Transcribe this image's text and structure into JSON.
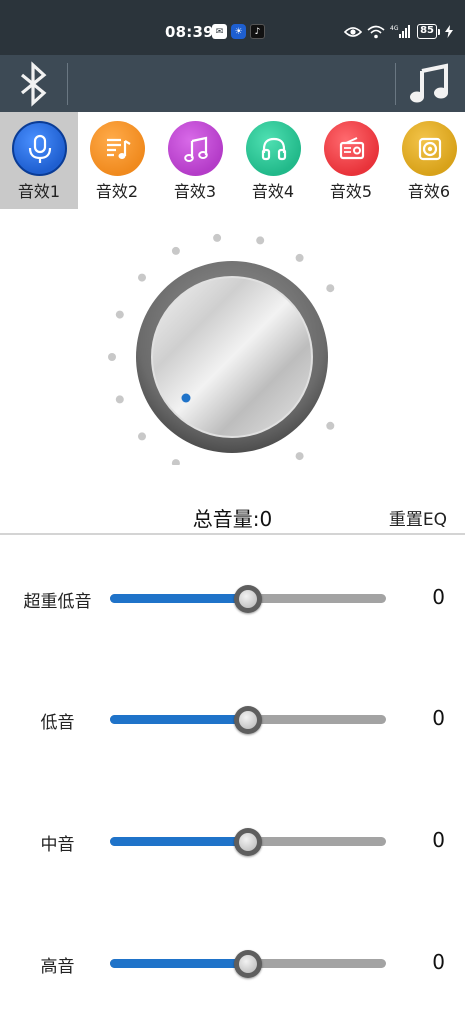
{
  "status": {
    "time": "08:39",
    "battery": "85",
    "network": "4G"
  },
  "presets": [
    {
      "label": "音效1",
      "color": "#1f5fd0",
      "icon": "microphone-icon",
      "active": true
    },
    {
      "label": "音效2",
      "color": "#f08a1e",
      "icon": "music-list-icon",
      "active": false
    },
    {
      "label": "音效3",
      "color": "#b43cc8",
      "icon": "music-note-icon",
      "active": false
    },
    {
      "label": "音效4",
      "color": "#22b98a",
      "icon": "headphones-icon",
      "active": false
    },
    {
      "label": "音效5",
      "color": "#e8333a",
      "icon": "radio-icon",
      "active": false
    },
    {
      "label": "音效6",
      "color": "#d8a21a",
      "icon": "speaker-icon",
      "active": false
    }
  ],
  "volume": {
    "label": "总音量:0",
    "reset_label": "重置EQ",
    "level": 0
  },
  "eq": [
    {
      "label": "超重低音",
      "value": "0",
      "position": 0.5
    },
    {
      "label": "低音",
      "value": "0",
      "position": 0.5
    },
    {
      "label": "中音",
      "value": "0",
      "position": 0.5
    },
    {
      "label": "高音",
      "value": "0",
      "position": 0.5
    }
  ],
  "colors": {
    "status_bar": "#2b343b",
    "toolbar": "#3d4a55",
    "slider_fill": "#1f73c9",
    "slider_track": "#a3a3a3",
    "active_preset_bg": "#c9c9c9"
  }
}
